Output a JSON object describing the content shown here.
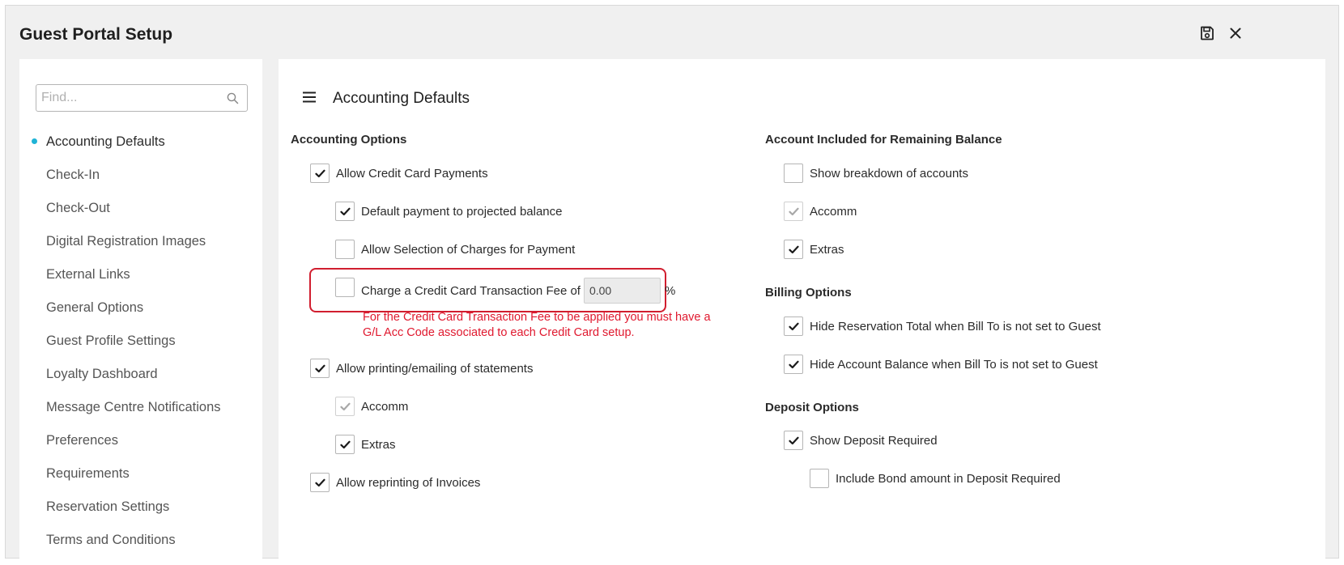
{
  "window": {
    "title": "Guest Portal Setup"
  },
  "sidebar": {
    "search_placeholder": "Find...",
    "items": [
      {
        "label": "Accounting Defaults",
        "active": true
      },
      {
        "label": "Check-In"
      },
      {
        "label": "Check-Out"
      },
      {
        "label": "Digital Registration Images"
      },
      {
        "label": "External Links"
      },
      {
        "label": "General Options"
      },
      {
        "label": "Guest Profile Settings"
      },
      {
        "label": "Loyalty Dashboard"
      },
      {
        "label": "Message Centre Notifications"
      },
      {
        "label": "Preferences"
      },
      {
        "label": "Requirements"
      },
      {
        "label": "Reservation Settings"
      },
      {
        "label": "Terms and Conditions"
      }
    ]
  },
  "main": {
    "title": "Accounting Defaults",
    "accounting_options": {
      "heading": "Accounting Options",
      "allow_cc": {
        "label": "Allow Credit Card Payments",
        "checked": true
      },
      "default_payment": {
        "label": "Default payment to projected balance",
        "checked": true
      },
      "allow_selection": {
        "label": "Allow Selection of Charges for Payment",
        "checked": false
      },
      "charge_fee": {
        "label": "Charge a Credit Card Transaction Fee of",
        "value": "0.00",
        "unit": "%",
        "checked": false
      },
      "fee_warning": "For the Credit Card Transaction Fee to be applied you must have a G/L Acc Code associated to each Credit Card setup.",
      "allow_printing": {
        "label": "Allow printing/emailing of statements",
        "checked": true
      },
      "print_accomm": {
        "label": "Accomm",
        "checked": true,
        "disabled": true
      },
      "print_extras": {
        "label": "Extras",
        "checked": true
      },
      "allow_reprinting": {
        "label": "Allow reprinting of Invoices",
        "checked": true
      }
    },
    "remaining_balance": {
      "heading": "Account Included for Remaining Balance",
      "show_breakdown": {
        "label": "Show breakdown of accounts",
        "checked": false
      },
      "accomm": {
        "label": "Accomm",
        "checked": true,
        "disabled": true
      },
      "extras": {
        "label": "Extras",
        "checked": true
      }
    },
    "billing_options": {
      "heading": "Billing Options",
      "hide_res_total": {
        "label": "Hide Reservation Total when Bill To is not set to Guest",
        "checked": true
      },
      "hide_acc_balance": {
        "label": "Hide Account Balance when Bill To is not set to Guest",
        "checked": true
      }
    },
    "deposit_options": {
      "heading": "Deposit Options",
      "show_deposit": {
        "label": "Show Deposit Required",
        "checked": true
      },
      "include_bond": {
        "label": "Include Bond amount in Deposit Required",
        "checked": false
      }
    }
  },
  "colors": {
    "accent": "#1fb3d6",
    "warning": "#e0192f",
    "highlight": "#d11e2f"
  }
}
